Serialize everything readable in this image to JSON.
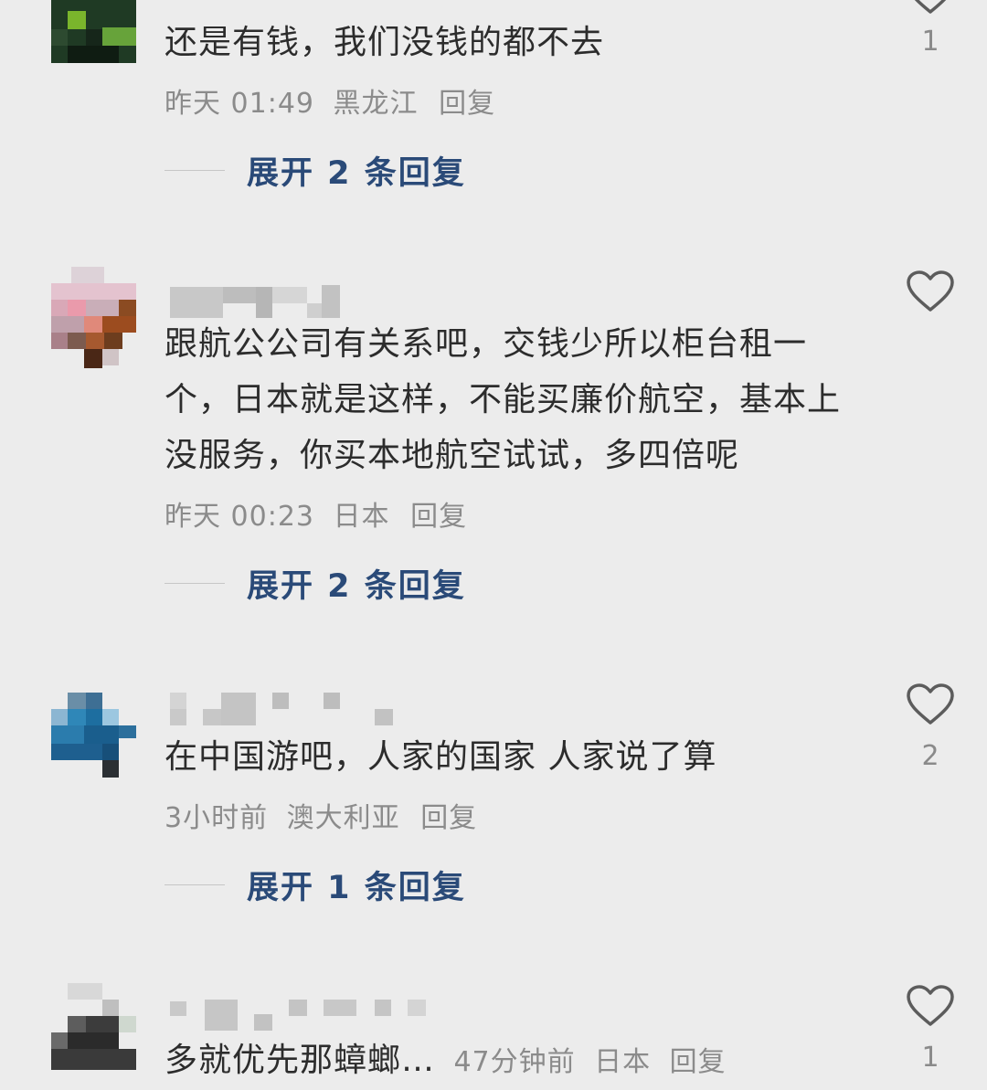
{
  "comments": [
    {
      "text": "还是有钱，我们没钱的都不去",
      "time": "昨天 01:49",
      "location": "黑龙江",
      "reply": "回复",
      "like_count": "1",
      "expand_label": "展开 2 条回复"
    },
    {
      "text": "跟航公公司有关系吧，交钱少所以柜台租一个，日本就是这样，不能买廉价航空，基本上没服务，你买本地航空试试，多四倍呢",
      "time": "昨天 00:23",
      "location": "日本",
      "reply": "回复",
      "like_count": "",
      "expand_label": "展开 2 条回复"
    },
    {
      "text": "在中国游吧，人家的国家 人家说了算",
      "time": "3小时前",
      "location": "澳大利亚",
      "reply": "回复",
      "like_count": "2",
      "expand_label": "展开 1 条回复"
    },
    {
      "text": "多就优先那蟑螂…",
      "time": "47分钟前",
      "location": "日本",
      "reply": "回复",
      "like_count": "1"
    }
  ],
  "icons": {
    "like": "heart-outline-icon",
    "avatar": "pixelated-avatar"
  },
  "colors": {
    "background": "#ececec",
    "text": "#2c2c2c",
    "meta": "#8b8b8b",
    "expand": "#2a4a78"
  }
}
